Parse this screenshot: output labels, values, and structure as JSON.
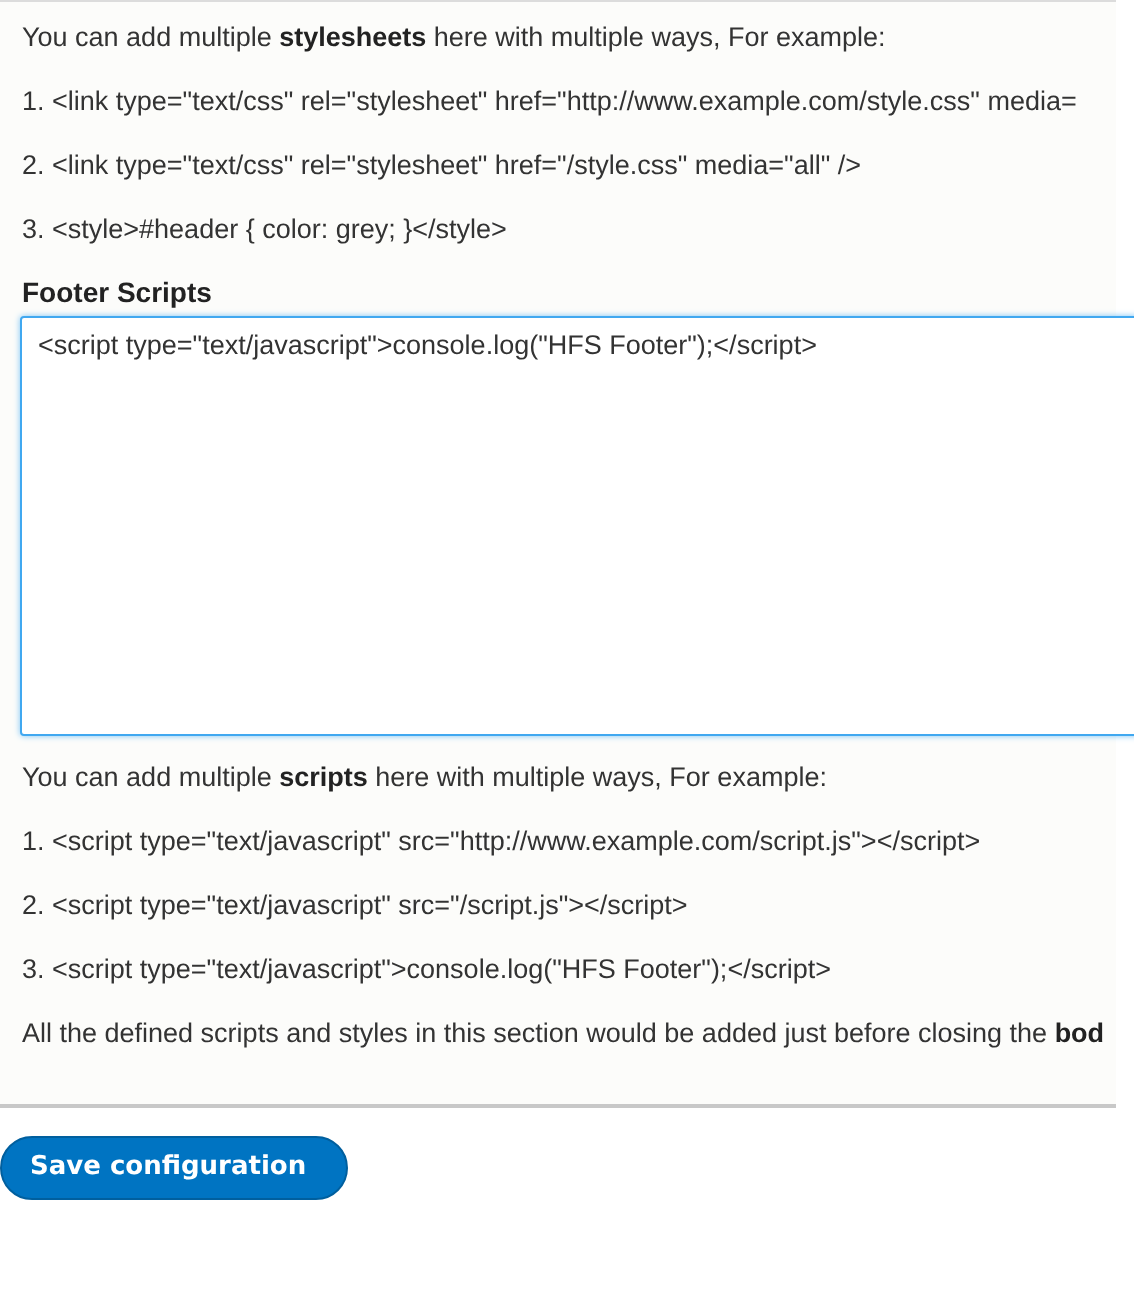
{
  "stylesheets_help": {
    "intro": "You can add multiple **stylesheets** here with multiple ways, For example:",
    "examples": [
      "1. <link type=\"text/css\" rel=\"stylesheet\" href=\"http://www.example.com/style.css\" media=",
      "2. <link type=\"text/css\" rel=\"stylesheet\" href=\"/style.css\" media=\"all\" />",
      "3. <style>#header { color: grey; }</style>"
    ]
  },
  "footer_scripts": {
    "label": "Footer Scripts",
    "value": "<script type=\"text/javascript\">console.log(\"HFS Footer\");</script>",
    "focused": true
  },
  "scripts_help": {
    "intro": "You can add multiple **scripts** here with multiple ways, For example:",
    "examples": [
      "1. <script type=\"text/javascript\" src=\"http://www.example.com/script.js\"></script>",
      "2. <script type=\"text/javascript\" src=\"/script.js\"></script>",
      "3. <script type=\"text/javascript\">console.log(\"HFS Footer\");</script>"
    ],
    "note": "All the defined scripts and styles in this section would be added just before closing the **bod**"
  },
  "buttons": [
    "Save configuration"
  ]
}
